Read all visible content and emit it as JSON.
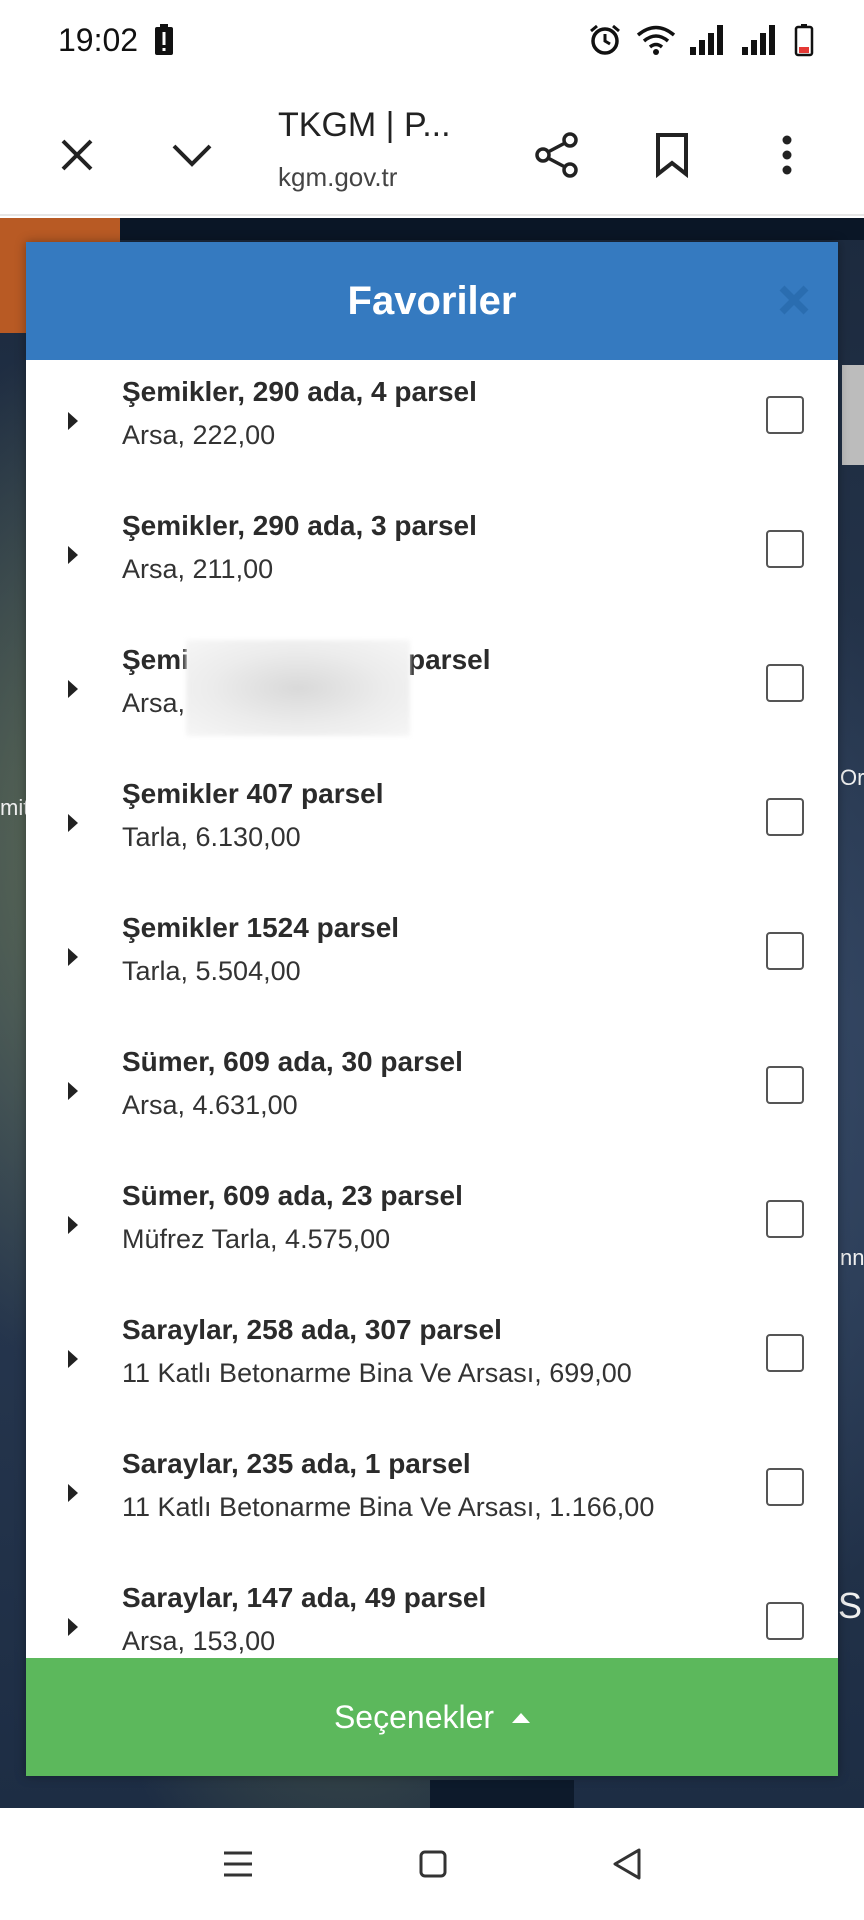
{
  "status_bar": {
    "time": "19:02"
  },
  "browser": {
    "title": "TKGM | P...",
    "url": "kgm.gov.tr"
  },
  "map": {
    "labels": [
      "mit",
      "Or",
      "nn",
      "S"
    ]
  },
  "modal": {
    "title": "Favoriler",
    "items": [
      {
        "title": "Şemikler, 290 ada, 4 parsel",
        "subtitle": "Arsa, 222,00"
      },
      {
        "title": "Şemikler, 290 ada, 3 parsel",
        "subtitle": "Arsa, 211,00"
      },
      {
        "title_start": "Şemi",
        "title_end": "parsel",
        "subtitle_start": "Arsa,"
      },
      {
        "title": "Şemikler 407 parsel",
        "subtitle": "Tarla, 6.130,00"
      },
      {
        "title": "Şemikler 1524 parsel",
        "subtitle": "Tarla, 5.504,00"
      },
      {
        "title": "Sümer, 609 ada, 30 parsel",
        "subtitle": "Arsa, 4.631,00"
      },
      {
        "title": "Sümer, 609 ada, 23 parsel",
        "subtitle": "Müfrez Tarla, 4.575,00"
      },
      {
        "title": "Saraylar, 258 ada, 307 parsel",
        "subtitle": "11 Katlı Betonarme Bina Ve Arsası, 699,00"
      },
      {
        "title": "Saraylar, 235 ada, 1 parsel",
        "subtitle": "11 Katlı Betonarme Bina Ve Arsası, 1.166,00"
      },
      {
        "title": "Saraylar, 147 ada, 49 parsel",
        "subtitle": "Arsa, 153,00"
      }
    ],
    "footer_label": "Seçenekler"
  },
  "colors": {
    "header": "#357ac0",
    "footer": "#5cb85c"
  }
}
